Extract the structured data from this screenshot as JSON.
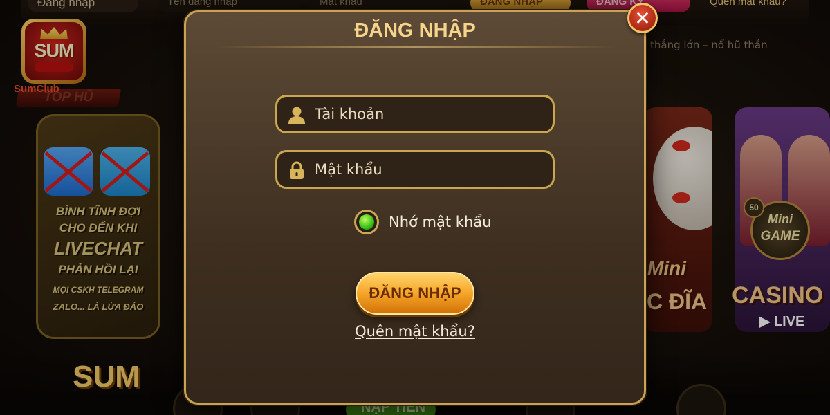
{
  "background": {
    "top_bar": {
      "login_label": "Đăng nhập",
      "username_placeholder": "Tên đăng nhập",
      "password_placeholder": "Mật khẩu",
      "login_button": "ĐĂNG NHẬP",
      "register_button": "ĐĂNG KÝ",
      "forgot_link": "Quên mật khẩu?"
    },
    "logo": {
      "brand": "SUM",
      "sub": "Club",
      "name": "SumClub"
    },
    "top_hu_label": "TOP HŨ",
    "speaker_text": "thắng lớn – nổ hũ thần",
    "notice": {
      "line1": "BÌNH TĨNH ĐỢI",
      "line2": "CHO ĐẾN KHI",
      "line3": "LIVECHAT",
      "line4": "PHẢN HỒI LẠI",
      "line5": "MỌI CSKH TELEGRAM",
      "line6": "ZALO... LÀ LỪA ĐẢO"
    },
    "games": {
      "disc_label_top": "Mini",
      "disc_label_bottom": "C ĐĨA",
      "casino_label": "CASINO",
      "live_label": "▶ LIVE",
      "mini_game_top": "Mini",
      "mini_game_bottom": "GAME",
      "badge": "50"
    },
    "bottom": {
      "deposit": "NẠP TIỀN",
      "logo": "SUM"
    }
  },
  "modal": {
    "title": "ĐĂNG NHẬP",
    "username_placeholder": "Tài khoản",
    "password_placeholder": "Mật khẩu",
    "remember_label": "Nhớ mật khẩu",
    "remember_checked": true,
    "login_button": "ĐĂNG NHẬP",
    "forgot_link": "Quên mật khẩu?",
    "close_icon": "close-icon",
    "user_icon": "user-icon",
    "lock_icon": "lock-icon"
  },
  "colors": {
    "gold_border": "#c9a64f",
    "modal_bg": "#4a3a2a",
    "login_button": "#f6a629",
    "close_button": "#c8321a",
    "radio_checked": "#3fd41e"
  }
}
